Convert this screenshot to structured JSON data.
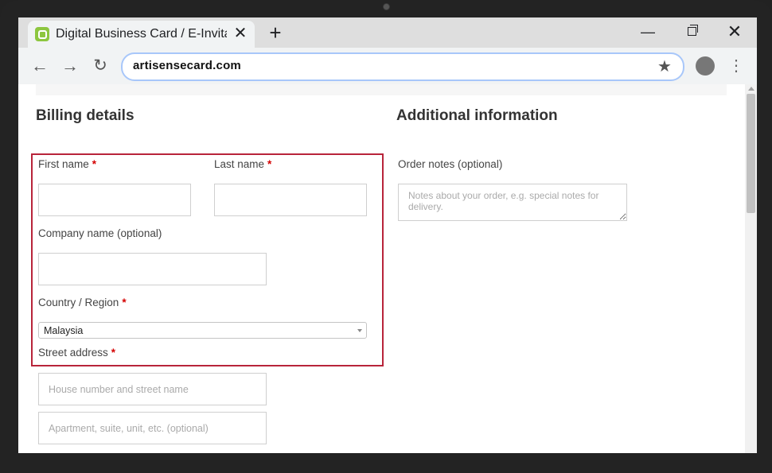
{
  "browser": {
    "tab_title": "Digital Business Card / E-Invita",
    "tab_close": "✕",
    "new_tab": "+",
    "window_min": "—",
    "window_close": "✕",
    "back": "←",
    "forward": "→",
    "reload": "↻",
    "url": "artisensecard.com",
    "bookmark": "★",
    "menu": "⋮"
  },
  "billing": {
    "heading": "Billing details",
    "required_mark": "*",
    "first_name_label": "First name",
    "last_name_label": "Last name",
    "company_label": "Company name (optional)",
    "country_label": "Country / Region",
    "country_value": "Malaysia",
    "street_label": "Street address",
    "street_placeholder": "House number and street name",
    "apartment_placeholder": "Apartment, suite, unit, etc. (optional)"
  },
  "additional": {
    "heading": "Additional information",
    "order_notes_label": "Order notes (optional)",
    "order_notes_placeholder": "Notes about your order, e.g. special notes for delivery."
  },
  "colors": {
    "highlight": "#b8243a",
    "required": "#d40000",
    "favicon": "#8dc63f"
  }
}
